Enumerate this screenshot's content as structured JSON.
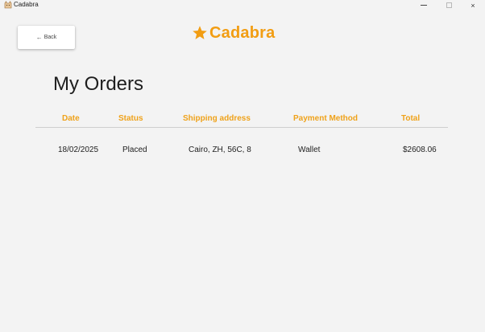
{
  "window": {
    "title": "Cadabra",
    "icon": "cat-app-icon",
    "controls": {
      "minimize": "minimize-icon",
      "maximize": "maximize-icon",
      "close": "×"
    }
  },
  "nav": {
    "back_label": "Back",
    "back_arrow": "←"
  },
  "brand": {
    "name": "Cadabra",
    "star_icon": "star-icon",
    "color": "#f29d12"
  },
  "page": {
    "title": "My Orders"
  },
  "orders": {
    "header_color": "#efa21a",
    "columns": [
      "Date",
      "Status",
      "Shipping address",
      "Payment Method",
      "Total"
    ],
    "rows": [
      {
        "date": "18/02/2025",
        "status": "Placed",
        "address": "Cairo, ZH, 56C, 8",
        "payment": "Wallet",
        "total": "$2608.06"
      }
    ]
  }
}
